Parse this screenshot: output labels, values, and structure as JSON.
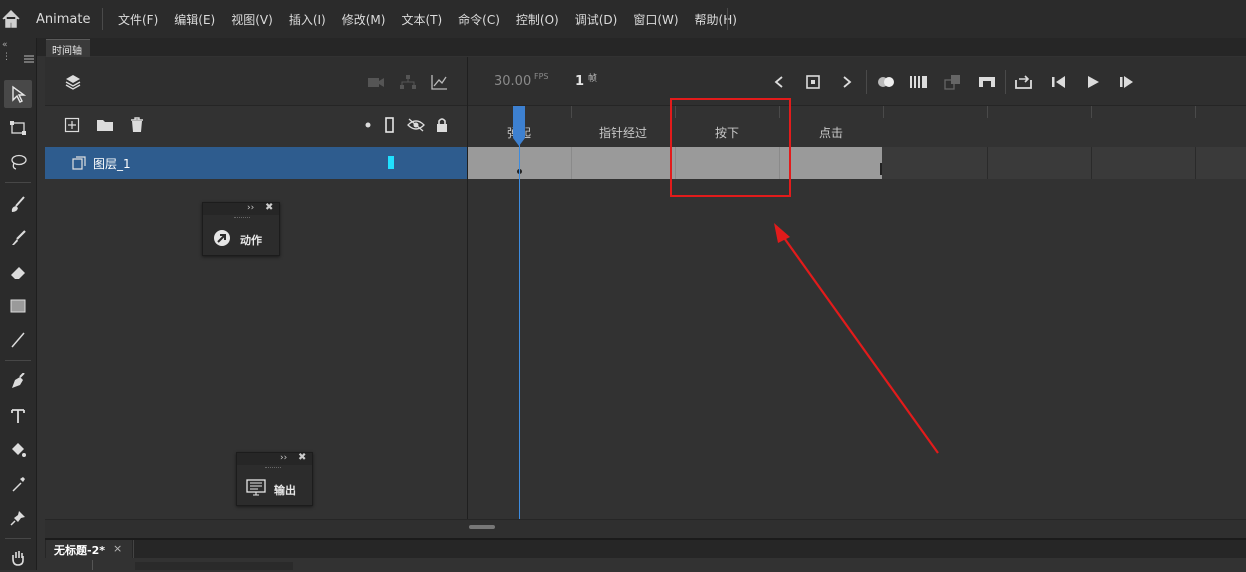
{
  "app": {
    "name": "Animate"
  },
  "menu": [
    "文件(F)",
    "编辑(E)",
    "视图(V)",
    "插入(I)",
    "修改(M)",
    "文本(T)",
    "命令(C)",
    "控制(O)",
    "调试(D)",
    "窗口(W)",
    "帮助(H)"
  ],
  "panel_tab": "时间轴",
  "timeline": {
    "fps_value": "30.00",
    "fps_unit": "FPS",
    "current_frame": "1",
    "frame_unit": "帧",
    "frame_labels": [
      "弹起",
      "指针经过",
      "按下",
      "点击"
    ],
    "layer": {
      "name": "图层_1",
      "color": "#20e0ff"
    }
  },
  "floating_panels": {
    "actions": {
      "label": "动作"
    },
    "output": {
      "label": "输出"
    }
  },
  "document": {
    "title": "无标题-2*",
    "close": "×"
  },
  "annotation": {
    "color": "#e21b1b"
  }
}
